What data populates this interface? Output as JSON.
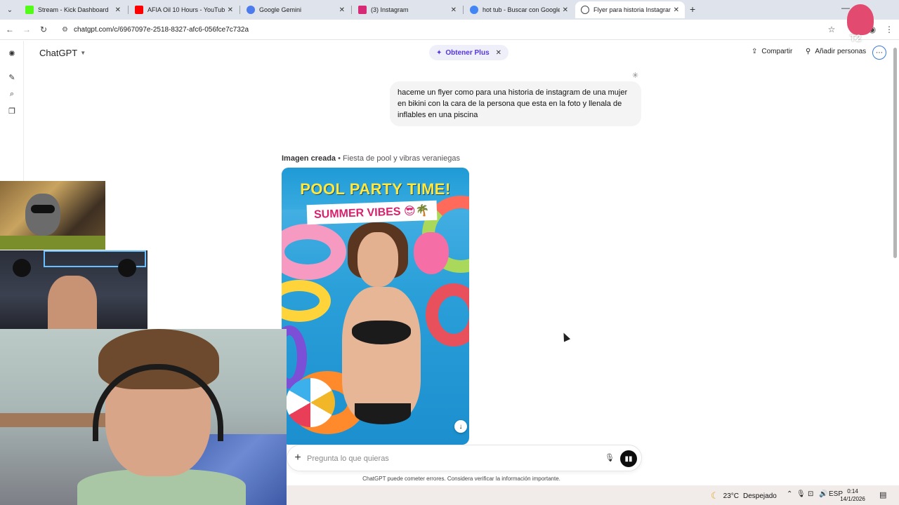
{
  "browser": {
    "tabs": [
      {
        "title": "Stream - Kick Dashboard",
        "favicon_color": "#53fc18",
        "active": false
      },
      {
        "title": "AFIA Oil 10 Hours - YouTube",
        "favicon_color": "#ff0000",
        "active": false
      },
      {
        "title": "Google Gemini",
        "favicon_color": "#4b7bec",
        "active": false
      },
      {
        "title": "(3) Instagram",
        "favicon_color": "#d62976",
        "active": false
      },
      {
        "title": "hot tub - Buscar con Google",
        "favicon_color": "#4285f4",
        "active": false
      },
      {
        "title": "Flyer para historia Instagram",
        "favicon_color": "#444444",
        "active": true
      }
    ],
    "url": "chatgpt.com/c/6967097e-2518-8327-afc6-056fce7c732a"
  },
  "app": {
    "brand": "ChatGPT",
    "get_plus": "Obtener Plus",
    "share": "Compartir",
    "add_people": "Añadir personas",
    "accent_color": "#5436da"
  },
  "conversation": {
    "user_message": "haceme un flyer como para una historia de instagram de una mujer en bikini con la cara de la persona que esta en la foto y llenala de inflables en una piscina",
    "image_label": "Imagen creada",
    "image_subtitle": "Fiesta de pool y vibras veraniegas",
    "flyer_title": "POOL PARTY TIME!",
    "flyer_subtitle": "SUMMER VIBES 😎🌴"
  },
  "composer": {
    "placeholder": "Pregunta lo que quieras",
    "disclaimer": "ChatGPT puede cometer errores. Considera verificar la información importante."
  },
  "taskbar": {
    "temperature": "23°C",
    "weather": "Despejado",
    "language": "ESP",
    "time": "0:14",
    "date": "14/1/2026"
  },
  "overlay": {
    "chibi_badge": "T2"
  }
}
